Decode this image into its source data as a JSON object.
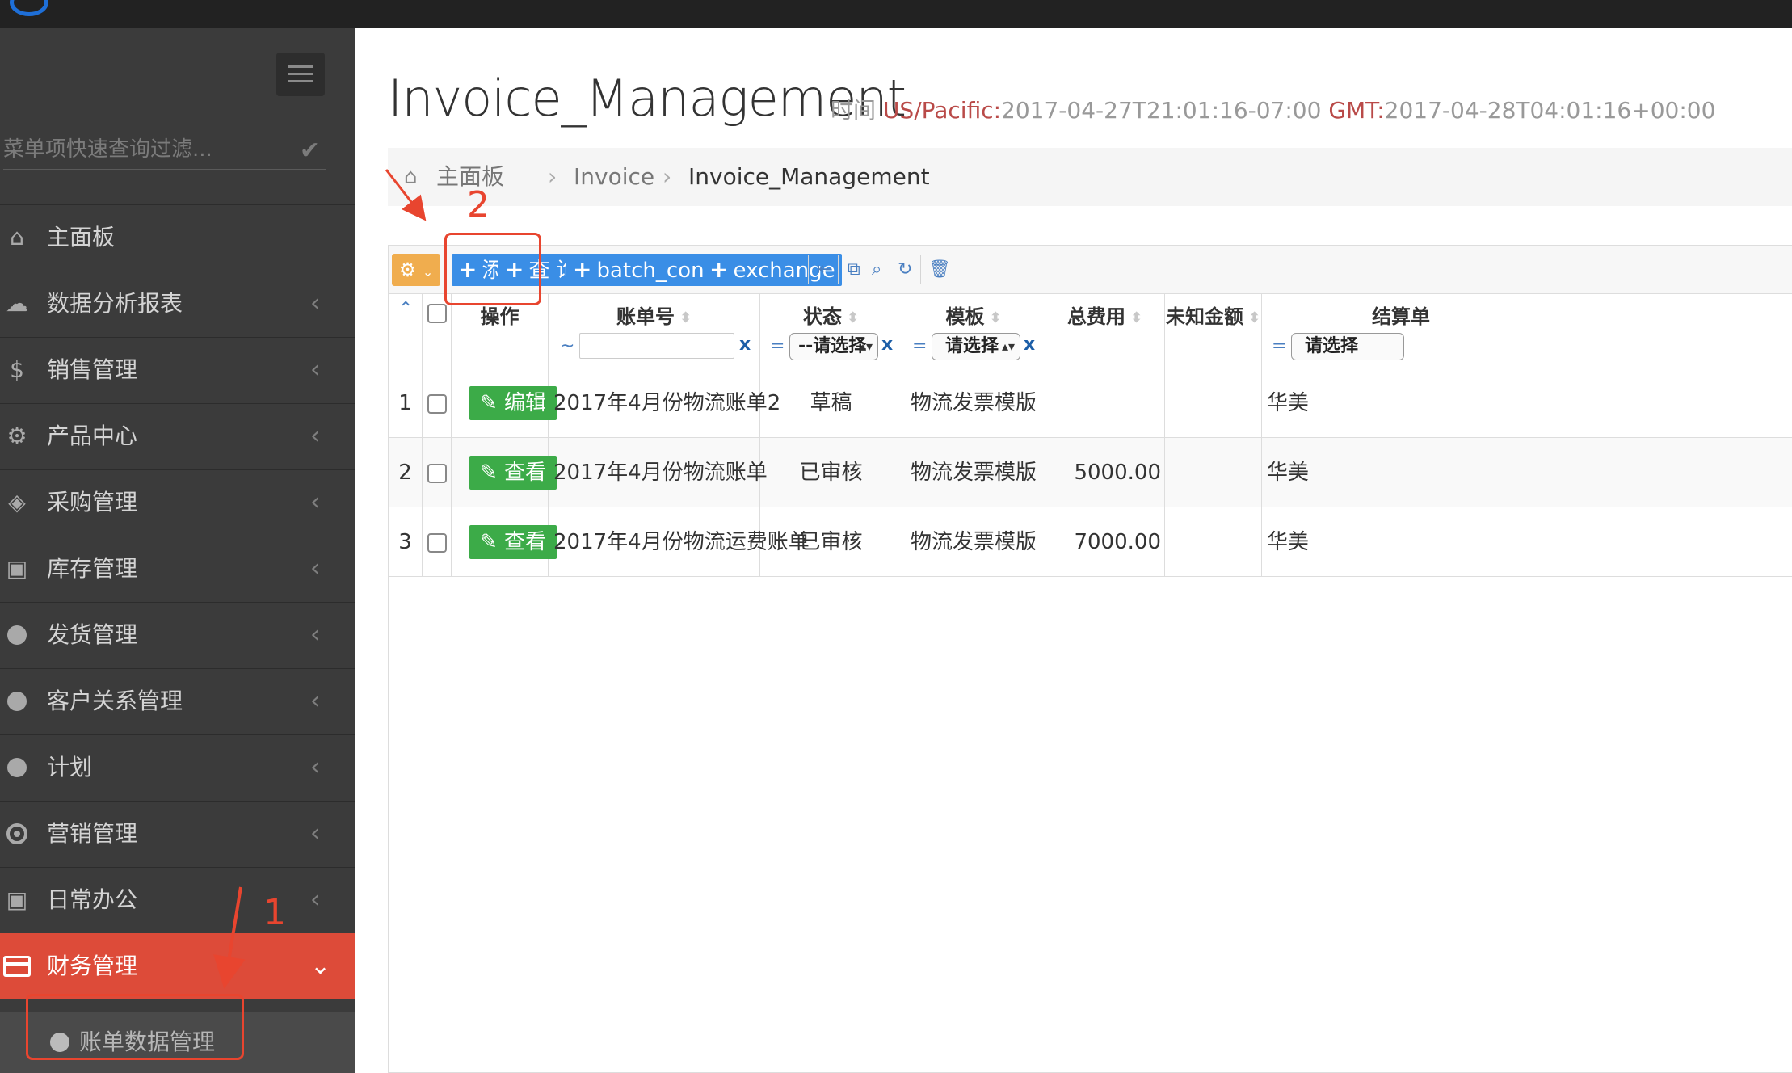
{
  "sidebar": {
    "search_placeholder": "菜单项快速查询过滤...",
    "items": [
      {
        "label": "主面板",
        "icon": "home-icon"
      },
      {
        "label": "数据分析报表",
        "icon": "cloud-icon"
      },
      {
        "label": "销售管理",
        "icon": "dollar-icon"
      },
      {
        "label": "产品中心",
        "icon": "gears-icon"
      },
      {
        "label": "采购管理",
        "icon": "cube-icon"
      },
      {
        "label": "库存管理",
        "icon": "android-icon"
      },
      {
        "label": "发货管理",
        "icon": "circle-icon"
      },
      {
        "label": "客户关系管理",
        "icon": "circle-icon"
      },
      {
        "label": "计划",
        "icon": "circle-icon"
      },
      {
        "label": "营销管理",
        "icon": "dot-circle-icon"
      },
      {
        "label": "日常办公",
        "icon": "android-icon"
      },
      {
        "label": "财务管理",
        "icon": "credit-card-icon",
        "active": true
      }
    ],
    "subitem": {
      "label": "账单数据管理"
    }
  },
  "header": {
    "title": "Invoice_Management",
    "time_label": "时间",
    "tz1_label": "US/Pacific:",
    "tz1_value": "2017-04-27T21:01:16-07:00",
    "tz2_label": "GMT:",
    "tz2_value": "2017-04-28T04:01:16+00:00"
  },
  "breadcrumb": {
    "home": "主面板",
    "parent": "Invoice",
    "current": "Invoice_Management",
    "sep": "›"
  },
  "toolbar": {
    "add": "添加",
    "query": "查 询",
    "batch_confirm": "batch_confirm",
    "exchange": "exchange"
  },
  "table": {
    "headers": {
      "action": "操作",
      "bill_no": "账单号",
      "status": "状态",
      "template": "模板",
      "total_fee": "总费用",
      "unknown_amount": "未知金额",
      "settlement": "结算单"
    },
    "filters": {
      "bill_no_op": "~",
      "status_op": "=",
      "status_value": "--请选择",
      "template_op": "=",
      "template_value": "请选择",
      "settlement_op": "=",
      "settlement_value": "请选择",
      "clear": "x"
    },
    "rows": [
      {
        "num": "1",
        "action": "编辑",
        "bill_no": "2017年4月份物流账单2",
        "status": "草稿",
        "template": "物流发票模版",
        "total_fee": "",
        "unknown_amount": "",
        "settlement": "华美"
      },
      {
        "num": "2",
        "action": "查看",
        "bill_no": "2017年4月份物流账单",
        "status": "已审核",
        "template": "物流发票模版",
        "total_fee": "5000.00",
        "unknown_amount": "",
        "settlement": "华美"
      },
      {
        "num": "3",
        "action": "查看",
        "bill_no": "2017年4月份物流运费账单",
        "status": "已审核",
        "template": "物流发票模版",
        "total_fee": "7000.00",
        "unknown_amount": "",
        "settlement": "华美"
      }
    ]
  },
  "annotations": {
    "step1": "1",
    "step2": "2"
  },
  "colors": {
    "accent_red": "#dd4b39",
    "button_blue": "#3a8ee6",
    "button_green": "#3cab48",
    "sidebar_bg": "#3b3b3b"
  }
}
